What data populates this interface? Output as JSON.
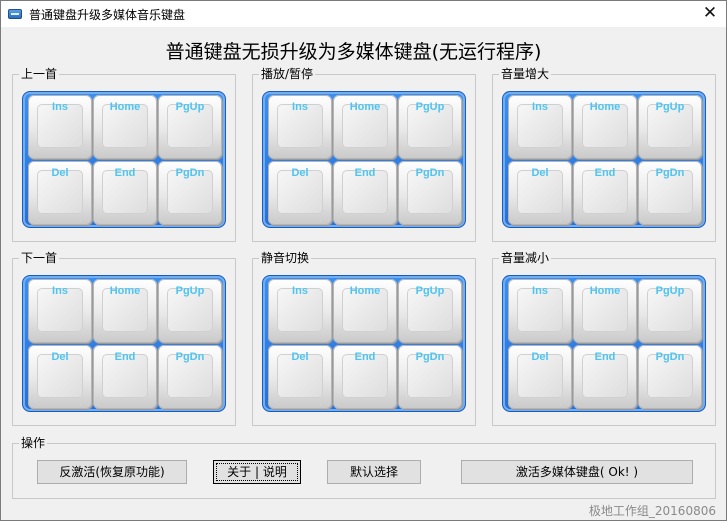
{
  "window": {
    "title": "普通键盘升级多媒体音乐键盘",
    "close_glyph": "✕"
  },
  "heading": "普通键盘无损升级为多媒体键盘(无运行程序)",
  "key_labels": [
    "Ins",
    "Home",
    "PgUp",
    "Del",
    "End",
    "PgDn"
  ],
  "groups": [
    {
      "label": "上一首"
    },
    {
      "label": "播放/暂停"
    },
    {
      "label": "音量增大"
    },
    {
      "label": "下一首"
    },
    {
      "label": "静音切换"
    },
    {
      "label": "音量减小"
    }
  ],
  "operations": {
    "label": "操作",
    "buttons": [
      "反激活(恢复原功能)",
      "关于 | 说明",
      "默认选择",
      "激活多媒体键盘( Ok! )"
    ]
  },
  "footer": "极地工作组_20160806",
  "colors": {
    "keypad_blue": "#2f7fe6",
    "key_label": "#4fc4f0"
  }
}
